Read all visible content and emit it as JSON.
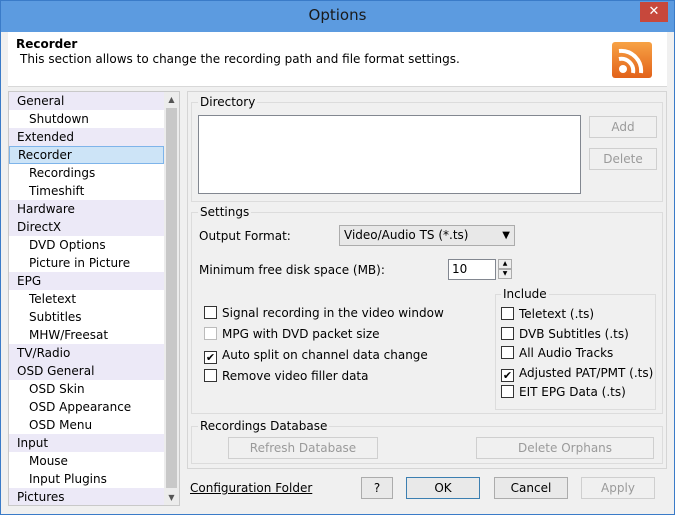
{
  "window": {
    "title": "Options",
    "close_glyph": "✕"
  },
  "header": {
    "title": "Recorder",
    "description": "This section allows to change the recording path and file format settings.",
    "icon": "rss-feed-icon"
  },
  "nav": {
    "items": [
      {
        "label": "General",
        "type": "cat"
      },
      {
        "label": "Shutdown",
        "type": "sub"
      },
      {
        "label": "Extended",
        "type": "cat"
      },
      {
        "label": "Recorder",
        "type": "cat",
        "selected": true
      },
      {
        "label": "Recordings",
        "type": "sub"
      },
      {
        "label": "Timeshift",
        "type": "sub"
      },
      {
        "label": "Hardware",
        "type": "cat"
      },
      {
        "label": "DirectX",
        "type": "cat"
      },
      {
        "label": "DVD Options",
        "type": "sub"
      },
      {
        "label": "Picture in Picture",
        "type": "sub"
      },
      {
        "label": "EPG",
        "type": "cat"
      },
      {
        "label": "Teletext",
        "type": "sub"
      },
      {
        "label": "Subtitles",
        "type": "sub"
      },
      {
        "label": "MHW/Freesat",
        "type": "sub"
      },
      {
        "label": "TV/Radio",
        "type": "cat"
      },
      {
        "label": "OSD General",
        "type": "cat"
      },
      {
        "label": "OSD Skin",
        "type": "sub"
      },
      {
        "label": "OSD Appearance",
        "type": "sub"
      },
      {
        "label": "OSD Menu",
        "type": "sub"
      },
      {
        "label": "Input",
        "type": "cat"
      },
      {
        "label": "Mouse",
        "type": "sub"
      },
      {
        "label": "Input Plugins",
        "type": "sub"
      },
      {
        "label": "Pictures",
        "type": "cat"
      }
    ]
  },
  "directory": {
    "legend": "Directory",
    "add": "Add",
    "delete": "Delete"
  },
  "settings": {
    "legend": "Settings",
    "output_format_label": "Output Format:",
    "output_format_value": "Video/Audio TS (*.ts)",
    "min_disk_label": "Minimum free disk space (MB):",
    "min_disk_value": "10",
    "options": [
      {
        "label": "Signal recording in the video window",
        "checked": false,
        "dim": false
      },
      {
        "label": "MPG with DVD packet size",
        "checked": false,
        "dim": true
      },
      {
        "label": "Auto split on channel data change",
        "checked": true,
        "dim": false
      },
      {
        "label": "Remove video filler data",
        "checked": false,
        "dim": false
      }
    ],
    "include": {
      "legend": "Include",
      "options": [
        {
          "label": "Teletext (.ts)",
          "checked": false
        },
        {
          "label": "DVB Subtitles (.ts)",
          "checked": false
        },
        {
          "label": "All Audio Tracks",
          "checked": false
        },
        {
          "label": "Adjusted PAT/PMT (.ts)",
          "checked": true
        },
        {
          "label": "EIT EPG Data (.ts)",
          "checked": false
        }
      ]
    }
  },
  "recdb": {
    "legend": "Recordings Database",
    "refresh": "Refresh Database",
    "delete_orphans": "Delete Orphans"
  },
  "footer": {
    "config_link": "Configuration Folder",
    "help": "?",
    "ok": "OK",
    "cancel": "Cancel",
    "apply": "Apply"
  }
}
